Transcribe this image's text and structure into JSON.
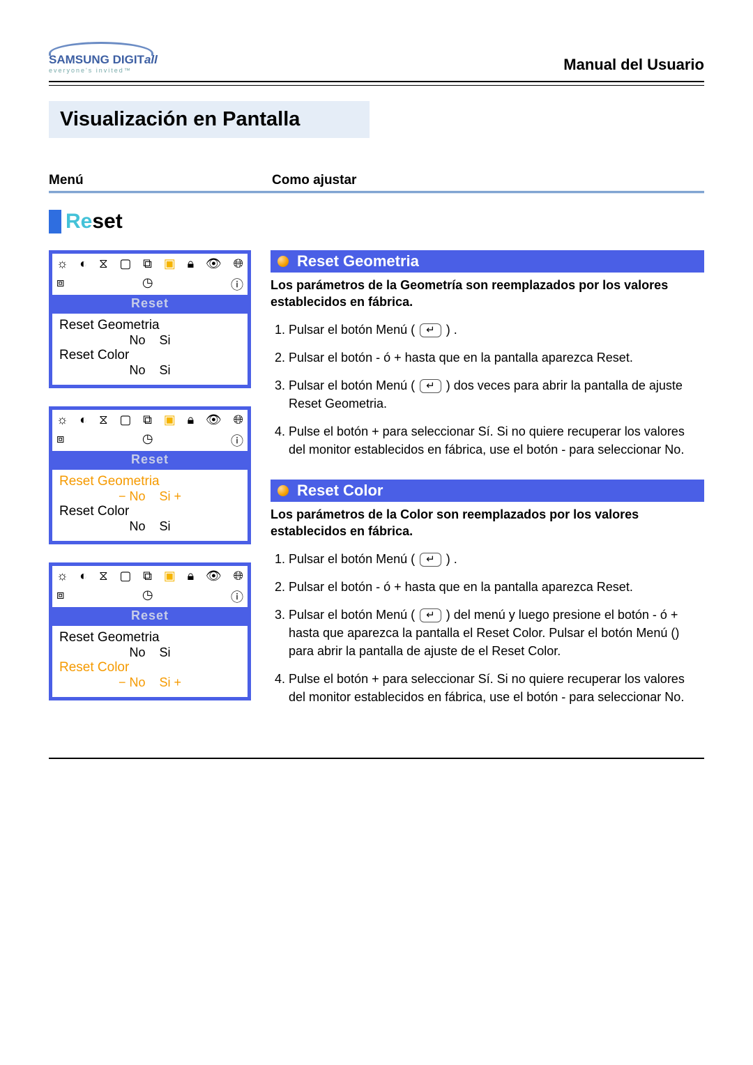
{
  "logo": {
    "brand": "SAMSUNG DIGIT",
    "brand_italic": "all",
    "tagline": "everyone's invited™"
  },
  "manual_label": "Manual del Usuario",
  "page_title": "Visualización en Pantalla",
  "columns": {
    "left": "Menú",
    "right": "Como ajustar"
  },
  "reset_heading": {
    "part1": "Re",
    "part2": "set"
  },
  "osd_common": {
    "label": "Reset",
    "geom": "Reset Geometria",
    "color": "Reset Color",
    "no": "No",
    "si": "Si",
    "minus_no": "−  No",
    "si_plus": "Si  +"
  },
  "sec_geom": {
    "title": "Reset Geometria",
    "lead": "Los parámetros de la Geometría son reemplazados por los valores establecidos en fábrica.",
    "steps": [
      "Pulsar el botón Menú (",
      "Pulsar el botón - ó + hasta que en la pantalla aparezca Reset.",
      "Pulsar el botón Menú (",
      "Pulse el botón + para seleccionar Sí. Si no quiere recuperar los valores del monitor establecidos en fábrica, use el botón - para seleccionar No."
    ],
    "step1_tail": " ) .",
    "step3_tail": " ) dos veces para abrir la pantalla de ajuste Reset Geometria."
  },
  "sec_color": {
    "title": "Reset Color",
    "lead": "Los parámetros de la Color son reemplazados por los valores establecidos en fábrica.",
    "steps": [
      "Pulsar el botón Menú (",
      "Pulsar el botón - ó + hasta que en la pantalla aparezca Reset.",
      "Pulsar el botón Menú (",
      "Pulse el botón + para seleccionar Sí.\nSi no quiere recuperar los valores del monitor establecidos en fábrica, use el botón - para seleccionar No."
    ],
    "step1_tail": " ) .",
    "step3_tail": " ) del menú y luego presione el botón - ó + hasta que aparezca la pantalla el Reset Color. Pulsar el botón Menú () para abrir la pantalla de ajuste de el Reset Color."
  },
  "menu_glyph": "↵"
}
